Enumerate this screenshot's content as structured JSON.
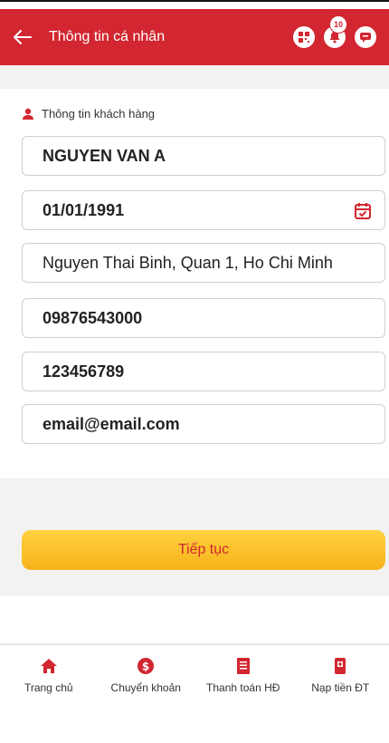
{
  "header": {
    "title": "Thông tin cá nhân",
    "badge_count": "10"
  },
  "section": {
    "title": "Thông tin khách hàng"
  },
  "fields": {
    "name": "NGUYEN VAN A",
    "dob": "01/01/1991",
    "address": "Nguyen Thai Binh, Quan 1, Ho Chi Minh",
    "phone": "09876543000",
    "id_number": "123456789",
    "email": "email@email.com"
  },
  "continue_label": "Tiếp tục",
  "tabs": [
    {
      "label": "Trang chủ",
      "icon": "home-icon"
    },
    {
      "label": "Chuyển khoản",
      "icon": "money-transfer-icon"
    },
    {
      "label": "Thanh toán HĐ",
      "icon": "bill-icon"
    },
    {
      "label": "Nạp tiền ĐT",
      "icon": "phone-topup-icon"
    }
  ],
  "colors": {
    "brand_red": "#d22630",
    "button_yellow": "#f6b21a",
    "background_gray": "#f2f2f2"
  }
}
